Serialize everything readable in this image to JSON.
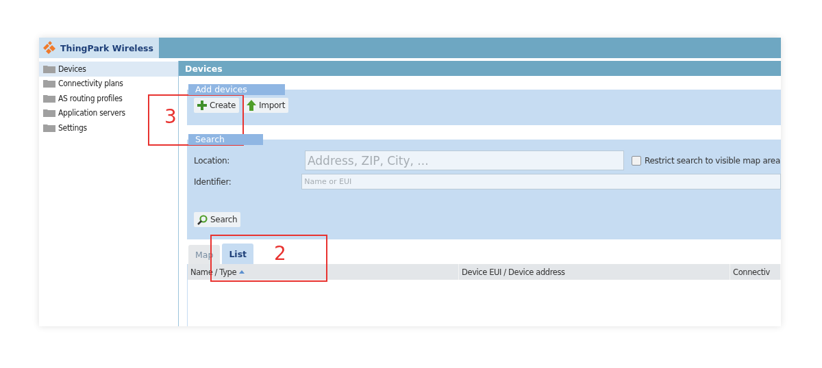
{
  "app": {
    "brand": "ThingPark Wireless"
  },
  "sidebar": {
    "items": [
      {
        "label": "Devices",
        "selected": true
      },
      {
        "label": "Connectivity plans",
        "selected": false
      },
      {
        "label": "AS routing profiles",
        "selected": false
      },
      {
        "label": "Application servers",
        "selected": false
      },
      {
        "label": "Settings",
        "selected": false
      }
    ]
  },
  "page": {
    "title": "Devices"
  },
  "add_devices": {
    "legend": "Add devices",
    "buttons": [
      {
        "label": "Create",
        "kind": "plus"
      },
      {
        "label": "Import",
        "kind": "up"
      }
    ]
  },
  "search": {
    "legend": "Search",
    "location": {
      "label": "Location:",
      "placeholder": "Address, ZIP, City, ..."
    },
    "restrict": {
      "label": "Restrict search to visible map area",
      "checked": false
    },
    "identifier": {
      "label": "Identifier:",
      "placeholder": "Name or EUI"
    },
    "button": "Search"
  },
  "tabs": [
    {
      "label": "Map",
      "selected": false
    },
    {
      "label": "List",
      "selected": true
    }
  ],
  "table": {
    "columns": [
      {
        "label": "Name / Type",
        "sorted": true
      },
      {
        "label": "Device EUI / Device address",
        "sorted": false
      },
      {
        "label": "Connectiv",
        "sorted": false
      }
    ]
  },
  "annotations": [
    {
      "number": "3"
    },
    {
      "number": "2"
    }
  ]
}
